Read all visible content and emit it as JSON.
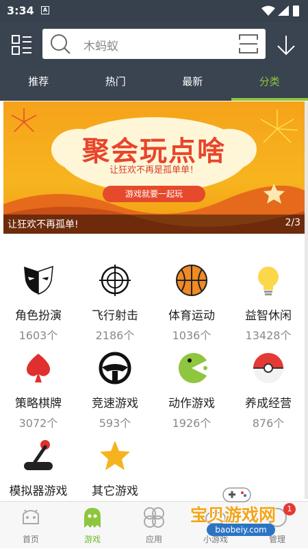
{
  "status_bar": {
    "time": "3:34",
    "notification_icon": "A"
  },
  "header": {
    "search_placeholder": "木蚂蚁",
    "tabs": [
      {
        "label": "推荐",
        "active": false
      },
      {
        "label": "热门",
        "active": false
      },
      {
        "label": "最新",
        "active": false
      },
      {
        "label": "分类",
        "active": true
      }
    ]
  },
  "banner": {
    "title": "聚会玩点啥",
    "subtitle": "让狂欢不再是孤单单！",
    "pill": "游戏就要一起玩",
    "caption": "让狂欢不再孤单!",
    "page": "2/3"
  },
  "categories": [
    {
      "name": "角色扮演",
      "count": "1603个",
      "icon": "mask-icon"
    },
    {
      "name": "飞行射击",
      "count": "2186个",
      "icon": "crosshair-icon"
    },
    {
      "name": "体育运动",
      "count": "1036个",
      "icon": "basketball-icon"
    },
    {
      "name": "益智休闲",
      "count": "13428个",
      "icon": "lightbulb-icon"
    },
    {
      "name": "策略棋牌",
      "count": "3072个",
      "icon": "spade-icon"
    },
    {
      "name": "竞速游戏",
      "count": "593个",
      "icon": "steering-wheel-icon"
    },
    {
      "name": "动作游戏",
      "count": "1926个",
      "icon": "pacman-icon"
    },
    {
      "name": "养成经营",
      "count": "876个",
      "icon": "pokeball-icon"
    },
    {
      "name": "模拟器游戏",
      "count": "",
      "icon": "joystick-icon"
    },
    {
      "name": "其它游戏",
      "count": "",
      "icon": "star-icon"
    }
  ],
  "bottom_nav": [
    {
      "label": "首页",
      "active": false
    },
    {
      "label": "游戏",
      "active": true
    },
    {
      "label": "应用",
      "active": false
    },
    {
      "label": "小游戏",
      "active": false
    },
    {
      "label": "管理",
      "active": false
    }
  ],
  "watermark": {
    "text": "宝贝游戏网",
    "url": "baobeiy.com",
    "badge": "1"
  },
  "colors": {
    "header_bg": "#3a4350",
    "accent": "#8ec63f",
    "banner_bg": "#f7b51f"
  }
}
